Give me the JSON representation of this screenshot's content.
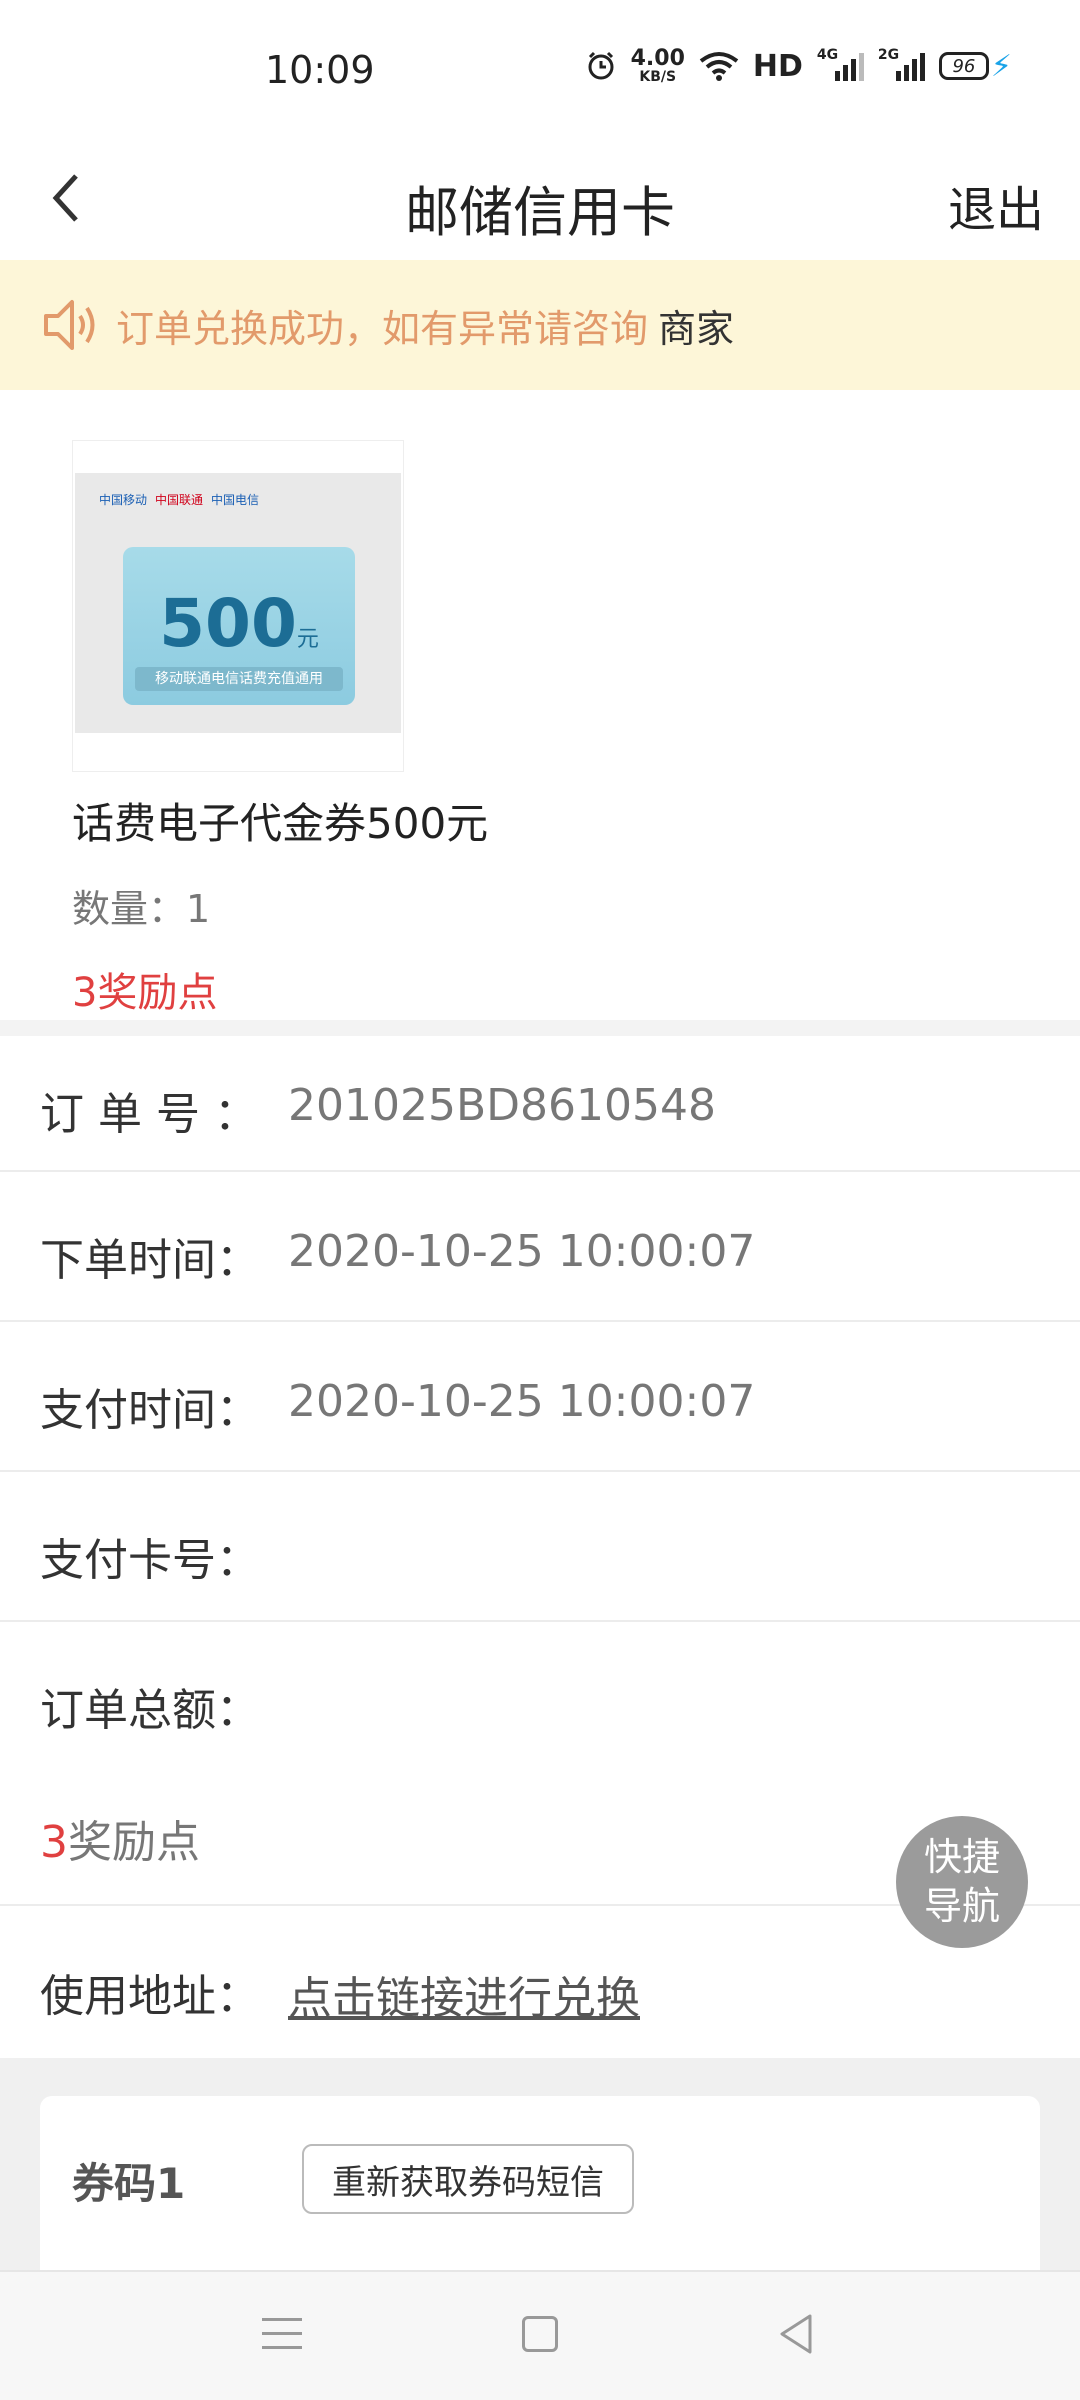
{
  "status_bar": {
    "time": "10:09",
    "net_speed_value": "4.00",
    "net_speed_unit": "KB/S",
    "hd": "HD",
    "sim1_label": "4G",
    "sim2_label": "2G",
    "battery": "96"
  },
  "nav": {
    "title": "邮储信用卡",
    "exit_label": "退出"
  },
  "notice": {
    "text": "订单兑换成功，如有异常请咨询",
    "link": "商家"
  },
  "product": {
    "card_value": "500",
    "card_unit": "元",
    "card_strip": "移动联通电信话费充值通用",
    "logo_1": "中国移动",
    "logo_2": "中国联通",
    "logo_3": "中国电信",
    "name": "话费电子代金券500元",
    "quantity": "数量：1",
    "points": "3奖励点"
  },
  "details": {
    "order_no_label": "订 单 号 ：",
    "order_no": "201025BD8610548",
    "order_time_label": "下单时间：",
    "order_time": "2020-10-25 10:00:07",
    "pay_time_label": "支付时间：",
    "pay_time": "2020-10-25 10:00:07",
    "card_no_label": "支付卡号：",
    "card_no": "",
    "total_label": "订单总额：",
    "total_points_num": "3",
    "total_points_text": "奖励点",
    "address_label": "使用地址：",
    "address_link": "点击链接进行兑换"
  },
  "fab": {
    "line1": "快捷",
    "line2": "导航"
  },
  "coupon": {
    "label": "券码1",
    "resend_button": "重新获取券码短信"
  },
  "colors": {
    "notice_bg": "#fdf6d8",
    "notice_text": "#e29a6b",
    "points_red": "#e04040",
    "fab_bg": "#9b9b9b"
  }
}
